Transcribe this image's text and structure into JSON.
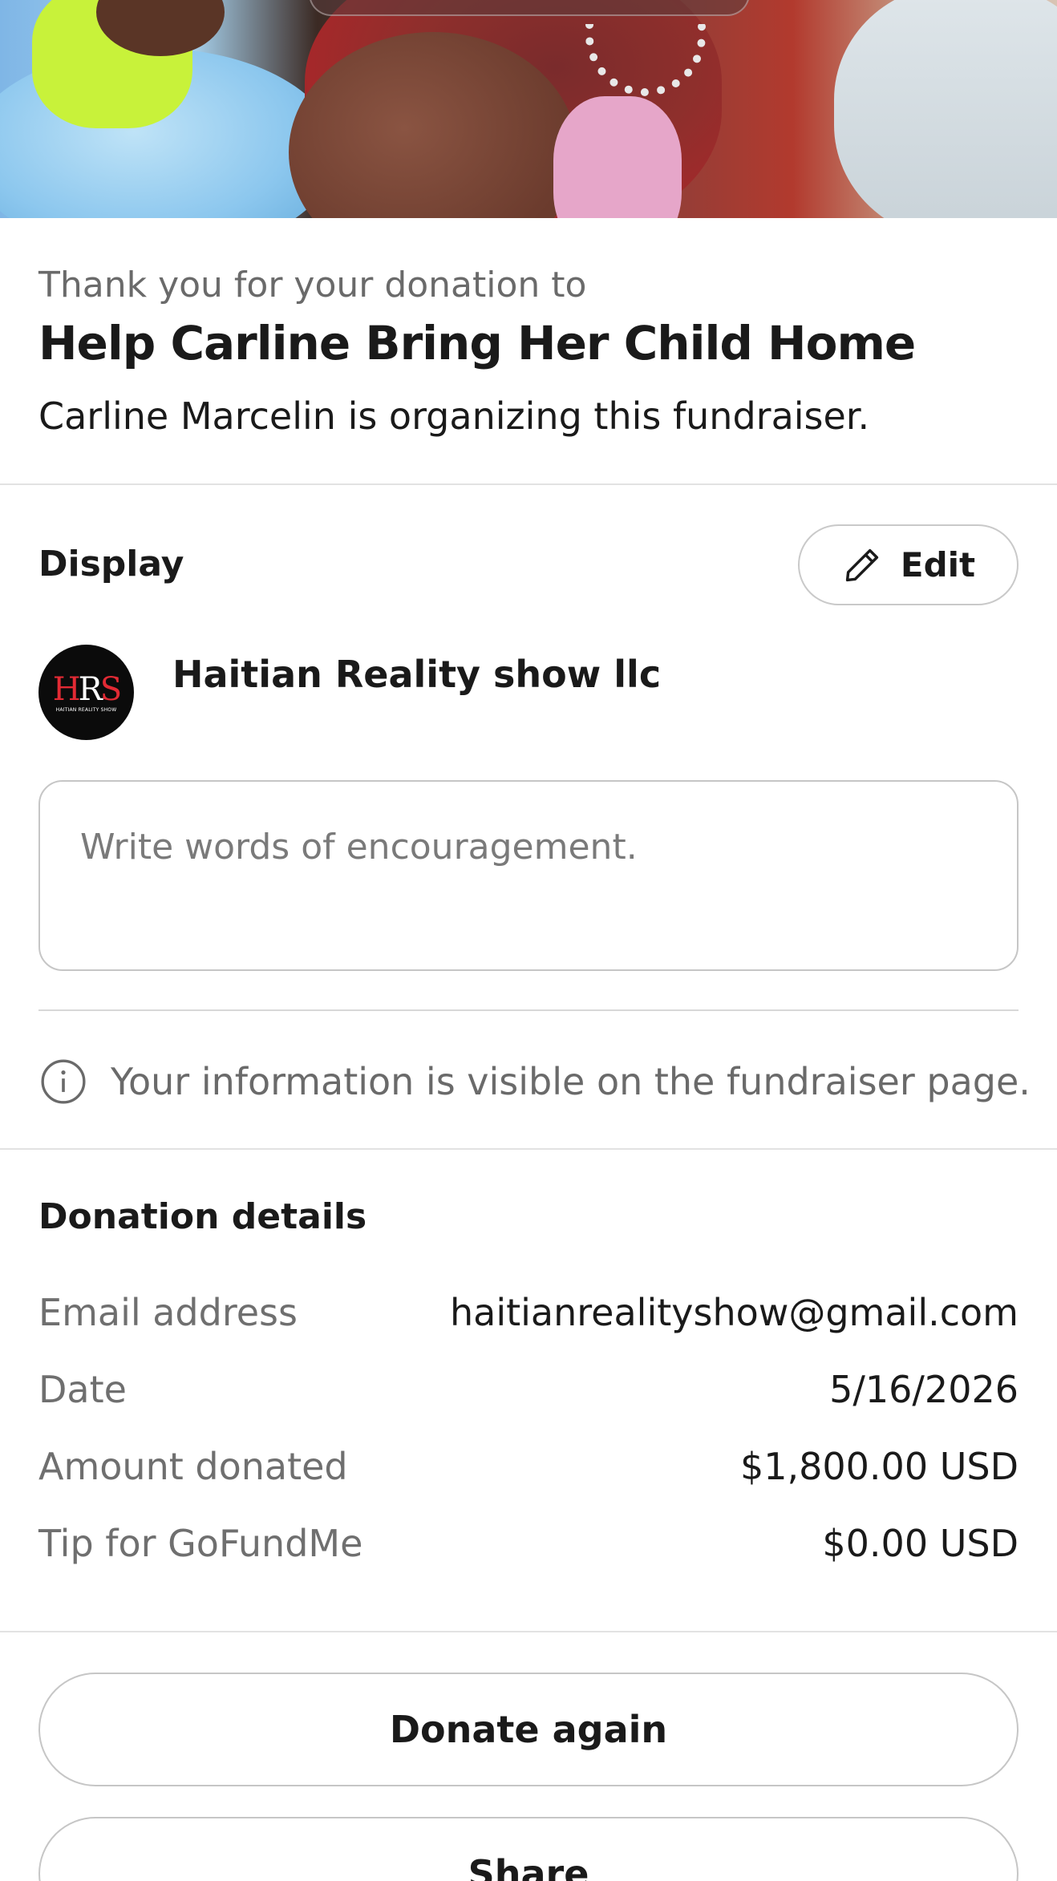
{
  "thanks": {
    "intro": "Thank you for your donation to",
    "fundraiser_title": "Help Carline Bring Her Child Home",
    "organizer_line": "Carline Marcelin is organizing this fundraiser."
  },
  "display": {
    "label": "Display",
    "edit_label": "Edit",
    "donor_name": "Haitian Reality show llc",
    "avatar_logo_text": "HRS",
    "avatar_subtext": "HAITIAN REALITY SHOW",
    "message_placeholder": "Write words of encouragement.",
    "visibility_note": "Your information is visible on the fundraiser page."
  },
  "details": {
    "title": "Donation details",
    "rows": [
      {
        "label": "Email address",
        "value": "haitianrealityshow@gmail.com"
      },
      {
        "label": "Date",
        "value": "5/16/2026"
      },
      {
        "label": "Amount donated",
        "value": "$1,800.00 USD"
      },
      {
        "label": "Tip for GoFundMe",
        "value": "$0.00 USD"
      }
    ]
  },
  "actions": {
    "donate_again": "Donate again",
    "share": "Share"
  }
}
